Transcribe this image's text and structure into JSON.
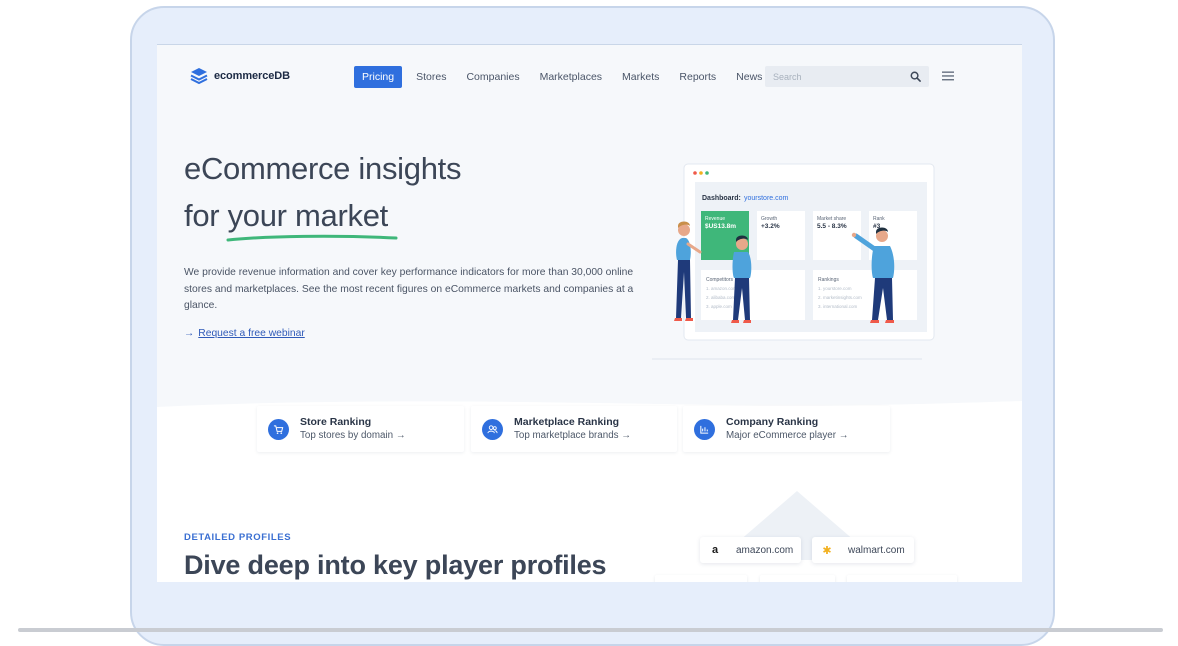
{
  "brand": {
    "name": "ecommerceDB"
  },
  "nav": {
    "items": [
      {
        "label": "Pricing",
        "active": true
      },
      {
        "label": "Stores"
      },
      {
        "label": "Companies"
      },
      {
        "label": "Marketplaces"
      },
      {
        "label": "Markets"
      },
      {
        "label": "Reports"
      },
      {
        "label": "News"
      }
    ],
    "search_placeholder": "Search"
  },
  "hero": {
    "title_line1": "eCommerce insights",
    "title_line2_prefix": "for ",
    "title_line2_highlight": "your market",
    "description": "We provide revenue information and cover key performance indicators for more than 30,000 online stores and marketplaces. See the most recent figures on eCommerce markets and companies at a glance.",
    "link_arrow": "→",
    "link_label": "Request a free webinar"
  },
  "dashboard": {
    "label": "Dashboard:",
    "domain": "yourstore.com",
    "kpis": [
      {
        "label": "Revenue",
        "value": "$US13.8m"
      },
      {
        "label": "Growth",
        "value": "+3.2%"
      },
      {
        "label": "Market share",
        "value": "5.5 - 8.3%"
      },
      {
        "label": "Rank",
        "value": "#3"
      }
    ],
    "competitors_label": "Competitors",
    "competitors": [
      "1. amazon.com",
      "2. alibaba.com",
      "3. apple.com"
    ],
    "rankings_label": "Rankings",
    "rankings": [
      "1. yourstore.com",
      "2. marketinsights.com",
      "3. international.com"
    ]
  },
  "rankings": [
    {
      "title": "Store Ranking",
      "subtitle": "Top stores by domain →",
      "icon": "cart-icon"
    },
    {
      "title": "Marketplace Ranking",
      "subtitle": "Top marketplace brands →",
      "icon": "users-icon"
    },
    {
      "title": "Company Ranking",
      "subtitle": "Major eCommerce player →",
      "icon": "chart-icon"
    }
  ],
  "profiles": {
    "kicker": "DETAILED PROFILES",
    "title": "Dive deep into key player profiles",
    "stores": [
      {
        "glyph": "a",
        "domain": "amazon.com",
        "color": "#1a1a1a"
      },
      {
        "glyph": "✱",
        "domain": "walmart.com",
        "color": "#f2b01e"
      }
    ]
  },
  "colors": {
    "primary": "#2f6fde",
    "accent_green": "#3fb77a",
    "figure_blue": "#4ea3dc",
    "figure_navy": "#1f3a7a"
  }
}
